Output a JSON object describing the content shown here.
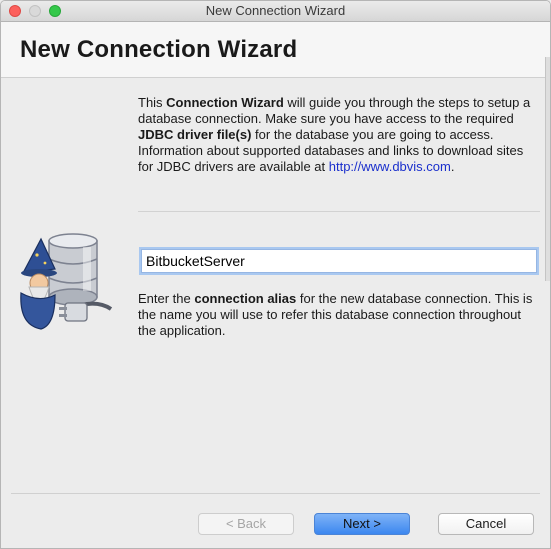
{
  "window": {
    "title": "New Connection Wizard"
  },
  "header": {
    "title": "New Connection Wizard"
  },
  "intro": {
    "t1": "This ",
    "b1": "Connection Wizard",
    "t2": " will guide you through the steps to setup a database connection. Make sure you have access to the required ",
    "b2": "JDBC driver file(s)",
    "t3": " for the database you are going to access.",
    "t4": "Information about supported databases and links to download sites for JDBC drivers are available at ",
    "link": "http://www.dbvis.com",
    "t5": "."
  },
  "alias": {
    "value": "BitbucketServer",
    "help_t1": "Enter the ",
    "help_b1": "connection alias",
    "help_t2": " for the new database connection. This is the name you will use to refer this database connection throughout the application."
  },
  "buttons": {
    "back": "< Back",
    "next": "Next >",
    "cancel": "Cancel"
  },
  "colors": {
    "accent": "#3c87ef",
    "link": "#1a2fcc"
  }
}
